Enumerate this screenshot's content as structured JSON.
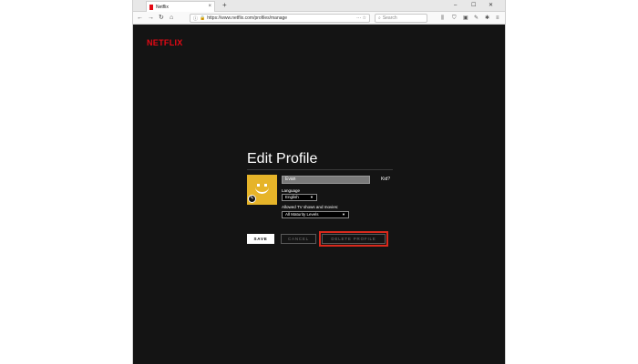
{
  "browser": {
    "tab_title": "Netflix",
    "tab_close": "×",
    "new_tab": "+",
    "window_controls": [
      "–",
      "☐",
      "✕"
    ],
    "nav": {
      "back": "←",
      "forward": "→",
      "reload": "↻",
      "home": "⌂"
    },
    "url": "https://www.netflix.com/profiles/manage",
    "url_actions": "··· ☆",
    "search_placeholder": "Search",
    "toolbar_icons": [
      "library-icon",
      "shield-icon",
      "sidebar-icon",
      "pen-icon",
      "addon-icon",
      "menu-icon"
    ]
  },
  "page": {
    "logo": "NETFLIX",
    "heading": "Edit Profile",
    "profile_name": "Evan",
    "kid_label": "Kid?",
    "language_label": "Language",
    "language_value": "English",
    "allowed_label": "Allowed TV shows and movies:",
    "maturity_value": "All Maturity Levels",
    "buttons": {
      "save": "SAVE",
      "cancel": "CANCEL",
      "delete": "DELETE PROFILE"
    }
  },
  "colors": {
    "brand": "#e50914",
    "page_bg": "#141414",
    "avatar": "#e6b429",
    "highlight": "#d9291c"
  }
}
